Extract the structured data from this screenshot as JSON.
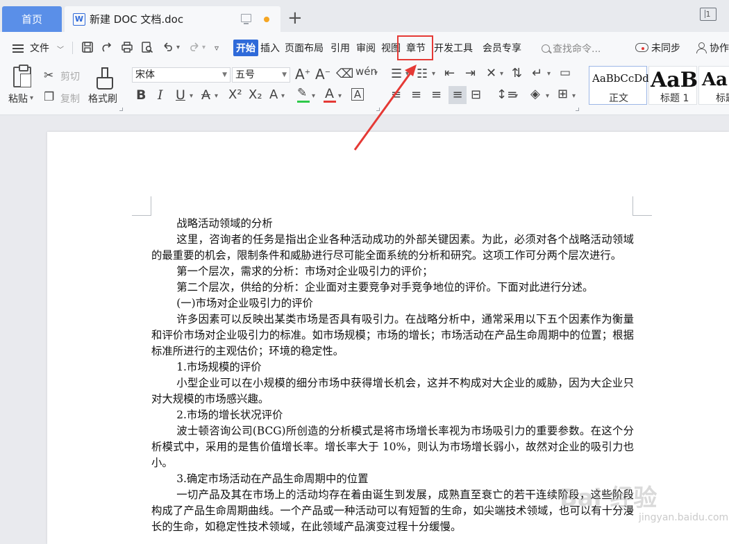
{
  "tabs": {
    "home": "首页",
    "document_title": "新建 DOC 文档.doc",
    "tab_count": "1"
  },
  "menu": {
    "file": "文件",
    "items": [
      "开始",
      "插入",
      "页面布局",
      "引用",
      "审阅",
      "视图",
      "章节",
      "开发工具",
      "会员专享"
    ],
    "search_placeholder": "查找命令...",
    "sync": "未同步",
    "collab": "协作"
  },
  "ribbon": {
    "paste": "粘贴",
    "cut": "剪切",
    "copy": "复制",
    "format_painter": "格式刷",
    "font_name": "宋体",
    "font_size": "五号",
    "styles": [
      {
        "sample": "AaBbCcDd",
        "label": "正文"
      },
      {
        "sample": "AaBl",
        "label": "标题 1"
      },
      {
        "sample": "Aa",
        "label": "标题"
      }
    ]
  },
  "document": {
    "title": "战略活动领域的分析",
    "paragraphs": [
      "这里，咨询者的任务是指出企业各种活动成功的外部关键因素。为此，必须对各个战略活动领域的最重要的机会，限制条件和威胁进行尽可能全面系统的分析和研究。这项工作可分两个层次进行。",
      "第一个层次，需求的分析：市场对企业吸引力的评价；",
      "第二个层次，供给的分析：企业面对主要竞争对手竞争地位的评价。下面对此进行分述。",
      "(一)市场对企业吸引力的评价",
      "许多因素可以反映出某类市场是否具有吸引力。在战略分析中，通常采用以下五个因素作为衡量和评价市场对企业吸引力的标准。如市场规模；市场的增长；市场活动在产品生命周期中的位置；根据标准所进行的主观估价；环境的稳定性。",
      "1.市场规模的评价",
      "小型企业可以在小规模的细分市场中获得增长机会，这并不构成对大企业的威胁，因为大企业只对大规模的市场感兴趣。",
      "2.市场的增长状况评价",
      "波士顿咨询公司(BCG)所创造的分析模式是将市场增长率视为市场吸引力的重要参数。在这个分析模式中，采用的是售价值增长率。增长率大于 10%，则认为市场增长弱小，故然对企业的吸引力也小。",
      "3.确定市场活动在产品生命周期中的位置",
      "一切产品及其在市场上的活动均存在着由诞生到发展，成熟直至衰亡的若干连续阶段，这些阶段构成了产品生命周期曲线。一个产品或一种活动可以有短暂的生命，如尖端技术领域，也可以有十分漫长的生命，如稳定性技术领域，在此领域产品演变过程十分缓慢。"
    ]
  },
  "watermark": {
    "logo": "Bai 经验",
    "url": "jingyan.baidu.com"
  },
  "colors": {
    "accent": "#2f6ad9",
    "home_tab": "#5a8fe8",
    "highlight": "#e53935",
    "highlighter_green": "#2ec94a",
    "font_color_red": "#e53935"
  }
}
